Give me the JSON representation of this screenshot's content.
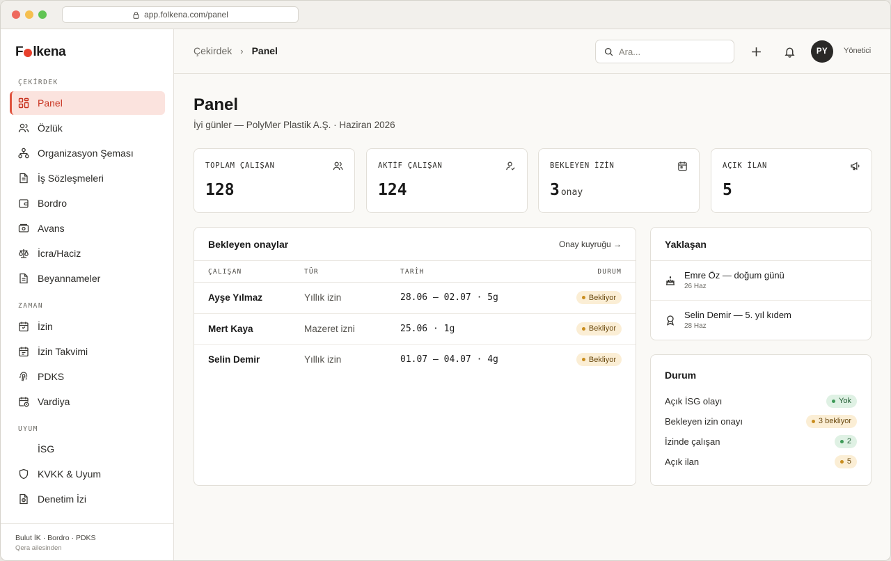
{
  "browser": {
    "url": "app.folkena.com/panel"
  },
  "brand": {
    "name_before": "F",
    "name_after": "lkena"
  },
  "sidebar": {
    "sections": [
      {
        "label": "ÇEKİRDEK"
      },
      {
        "label": "ZAMAN"
      },
      {
        "label": "UYUM"
      }
    ],
    "items": [
      {
        "label": "Panel",
        "icon": "dashboard-grid-icon",
        "active": true
      },
      {
        "label": "Özlük",
        "icon": "people-icon"
      },
      {
        "label": "Organizasyon Şeması",
        "icon": "org-chart-icon"
      },
      {
        "label": "İş Sözleşmeleri",
        "icon": "document-icon"
      },
      {
        "label": "Bordro",
        "icon": "wallet-icon"
      },
      {
        "label": "Avans",
        "icon": "cash-icon"
      },
      {
        "label": "İcra/Haciz",
        "icon": "scale-icon"
      },
      {
        "label": "Beyannameler",
        "icon": "document-icon"
      },
      {
        "label": "İzin",
        "icon": "calendar-icon"
      },
      {
        "label": "İzin Takvimi",
        "icon": "calendar-icon"
      },
      {
        "label": "PDKS",
        "icon": "fingerprint-icon"
      },
      {
        "label": "Vardiya",
        "icon": "calendar-clock-icon"
      },
      {
        "label": "İSG",
        "icon": ""
      },
      {
        "label": "KVKK & Uyum",
        "icon": "shield-icon"
      },
      {
        "label": "Denetim İzi",
        "icon": "audit-icon"
      }
    ],
    "footer": {
      "line1": "Bulut İK · Bordro · PDKS",
      "line2": "Qera ailesinden"
    }
  },
  "topbar": {
    "breadcrumb": {
      "parent": "Çekirdek",
      "separator": "›",
      "current": "Panel"
    },
    "search": {
      "placeholder": "Ara..."
    },
    "avatar_initials": "PY",
    "role": "Yönetici"
  },
  "page": {
    "title": "Panel",
    "subtitle": "İyi günler — PolyMer Plastik A.Ş. · Haziran 2026"
  },
  "stats": [
    {
      "label": "TOPLAM ÇALIŞAN",
      "value": "128",
      "unit": "",
      "icon": "people-icon"
    },
    {
      "label": "AKTİF ÇALIŞAN",
      "value": "124",
      "unit": "",
      "icon": "user-check-icon"
    },
    {
      "label": "BEKLEYEN İZİN",
      "value": "3",
      "unit": "onay",
      "icon": "calendar-icon"
    },
    {
      "label": "AÇIK İLAN",
      "value": "5",
      "unit": "",
      "icon": "megaphone-icon"
    }
  ],
  "approvals": {
    "title": "Bekleyen onaylar",
    "link": "Onay kuyruğu →",
    "columns": [
      "ÇALIŞAN",
      "TÜR",
      "TARİH",
      "DURUM"
    ],
    "rows": [
      {
        "name": "Ayşe Yılmaz",
        "type": "Yıllık izin",
        "date": "28.06 – 02.07 · 5g",
        "status": "Bekliyor"
      },
      {
        "name": "Mert Kaya",
        "type": "Mazeret izni",
        "date": "25.06 · 1g",
        "status": "Bekliyor"
      },
      {
        "name": "Selin Demir",
        "type": "Yıllık izin",
        "date": "01.07 – 04.07 · 4g",
        "status": "Bekliyor"
      }
    ]
  },
  "upcoming": {
    "title": "Yaklaşan",
    "items": [
      {
        "text": "Emre Öz — doğum günü",
        "date": "26 Haz",
        "icon": "cake-icon"
      },
      {
        "text": "Selin Demir — 5. yıl kıdem",
        "date": "28 Haz",
        "icon": "award-icon"
      }
    ]
  },
  "status": {
    "title": "Durum",
    "rows": [
      {
        "label": "Açık İSG olayı",
        "value": "Yok",
        "tone": "ok"
      },
      {
        "label": "Bekleyen izin onayı",
        "value": "3 bekliyor",
        "tone": "warn"
      },
      {
        "label": "İzinde çalışan",
        "value": "2",
        "tone": "ok"
      },
      {
        "label": "Açık ilan",
        "value": "5",
        "tone": "warn"
      }
    ]
  },
  "colors": {
    "accent": "#e8402c",
    "active_bg": "#fbe3de",
    "warn_bg": "#fbeed5",
    "ok_bg": "#dff1e4"
  }
}
